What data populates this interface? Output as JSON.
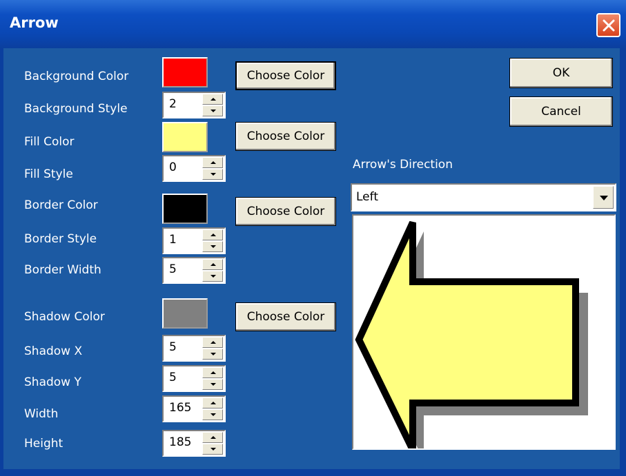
{
  "window": {
    "title": "Arrow"
  },
  "fields": {
    "background_color": {
      "label": "Background Color",
      "color": "#ff0000",
      "button": "Choose Color"
    },
    "background_style": {
      "label": "Background Style",
      "value": "2"
    },
    "fill_color": {
      "label": "Fill Color",
      "color": "#ffff80",
      "button": "Choose Color"
    },
    "fill_style": {
      "label": "Fill Style",
      "value": "0"
    },
    "border_color": {
      "label": "Border Color",
      "color": "#000000",
      "button": "Choose Color"
    },
    "border_style": {
      "label": "Border Style",
      "value": "1"
    },
    "border_width": {
      "label": "Border Width",
      "value": "5"
    },
    "shadow_color": {
      "label": "Shadow Color",
      "color": "#808080",
      "button": "Choose Color"
    },
    "shadow_x": {
      "label": "Shadow X",
      "value": "5"
    },
    "shadow_y": {
      "label": "Shadow Y",
      "value": "5"
    },
    "width": {
      "label": "Width",
      "value": "165"
    },
    "height": {
      "label": "Height",
      "value": "185"
    }
  },
  "buttons": {
    "ok": "OK",
    "cancel": "Cancel"
  },
  "direction": {
    "label": "Arrow's Direction",
    "selected": "Left"
  },
  "icons": {
    "close": "close-icon",
    "spin": "spin-arrows-icon",
    "dropdown": "chevron-down-icon"
  }
}
